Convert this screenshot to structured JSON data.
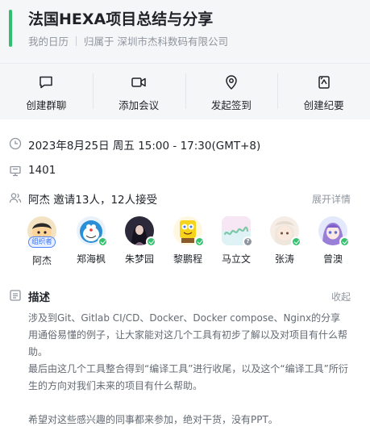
{
  "header": {
    "title": "法国HEXA项目总结与分享",
    "calendar": "我的日历",
    "owner": "归属于 深圳市杰科数码有限公司",
    "accent": "#2fbf6f"
  },
  "actions": [
    {
      "label": "创建群聊",
      "icon": "chat-bubble-icon"
    },
    {
      "label": "添加会议",
      "icon": "video-camera-icon"
    },
    {
      "label": "发起签到",
      "icon": "location-pin-icon"
    },
    {
      "label": "创建纪要",
      "icon": "document-note-icon"
    }
  ],
  "event": {
    "time": "2023年8月25日 周五 15:00 - 17:30(GMT+8)",
    "room": "1401"
  },
  "attendees": {
    "summary": "阿杰 邀请13人，12人接受",
    "expand_label": "展开详情",
    "organizer_badge": "组织者",
    "people": [
      {
        "name": "阿杰",
        "status": "organizer"
      },
      {
        "name": "郑海枫",
        "status": "accepted"
      },
      {
        "name": "朱梦园",
        "status": "accepted"
      },
      {
        "name": "黎鹏程",
        "status": "accepted"
      },
      {
        "name": "马立文",
        "status": "pending"
      },
      {
        "name": "张涛",
        "status": "accepted"
      },
      {
        "name": "曾澳",
        "status": "accepted"
      }
    ]
  },
  "description": {
    "title": "描述",
    "collapse_label": "收起",
    "lines": [
      "涉及到Git、Gitlab CI/CD、Docker、Docker compose、Nginx的分享",
      "用通俗易懂的例子，让大家能对这几个工具有初步了解以及对项目有什么帮",
      "助。",
      "最后由这几个工具整合得到“编译工具”进行收尾，以及这个“编译工具”所衍",
      "生的方向对我们未来的项目有什么帮助。",
      "",
      "希望对这些感兴趣的同事都来参加，绝对干货，没有PPT。"
    ]
  }
}
